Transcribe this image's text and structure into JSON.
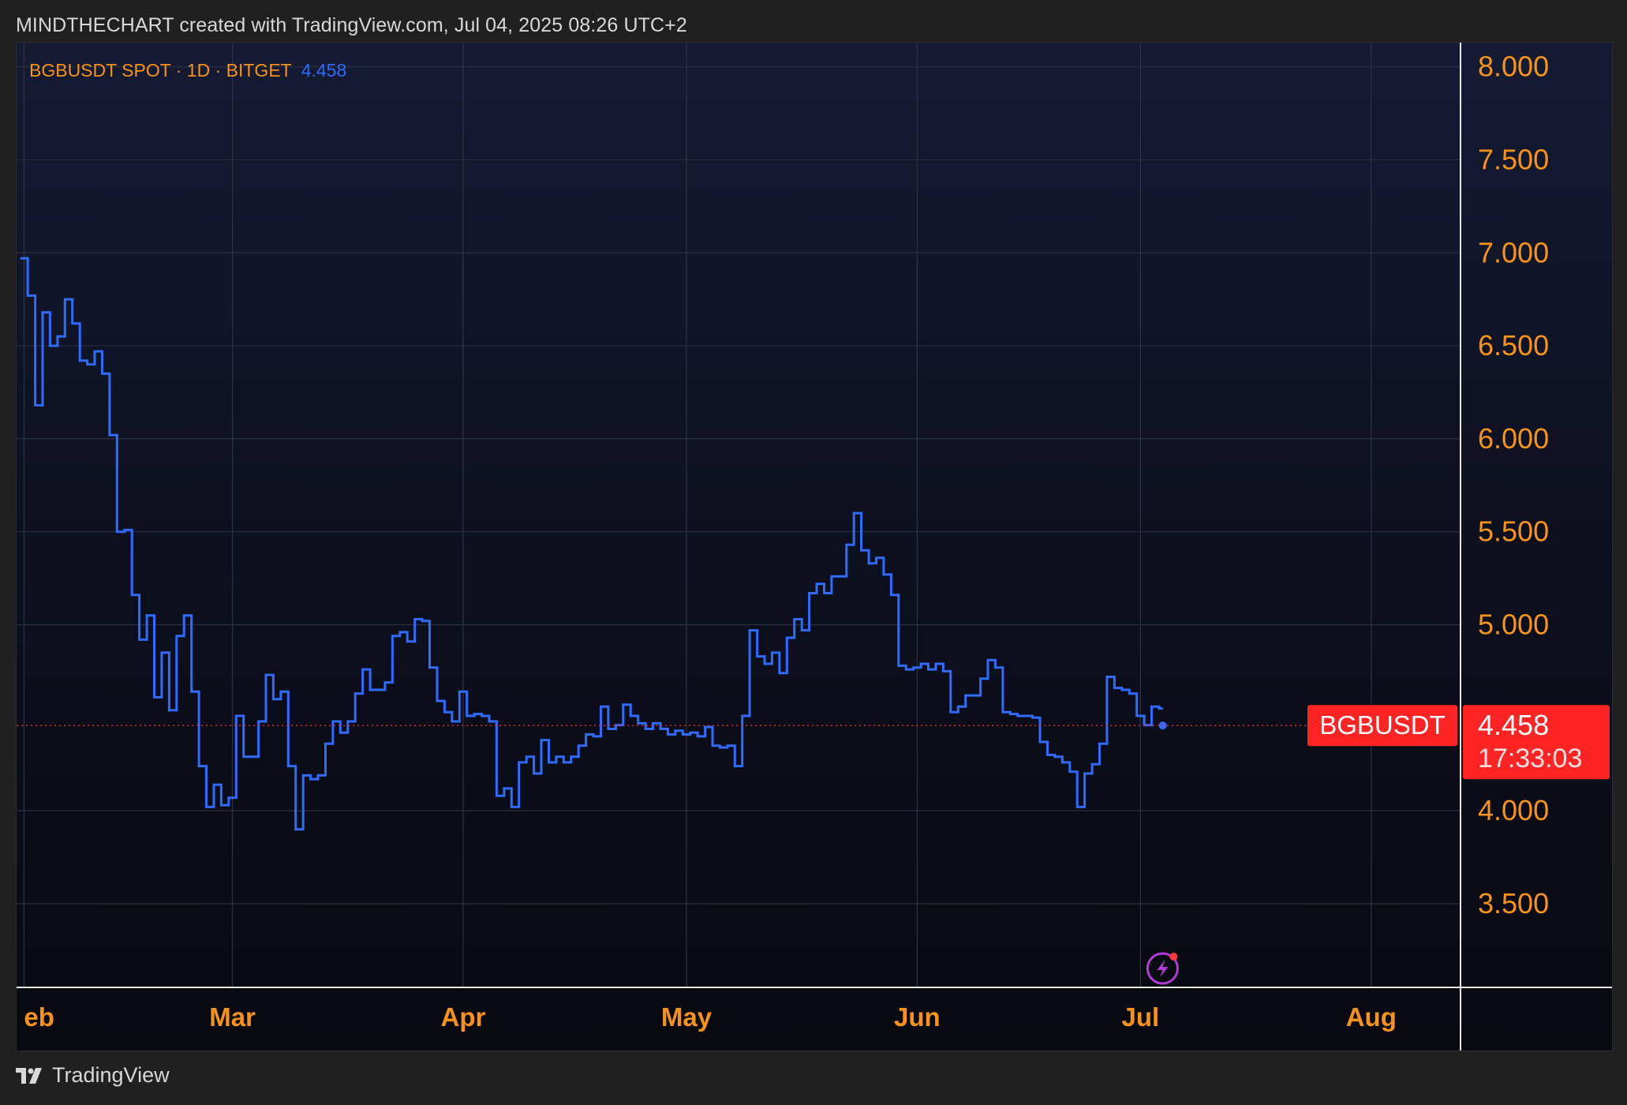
{
  "header": {
    "attribution": "MINDTHECHART created with TradingView.com, Jul 04, 2025 08:26 UTC+2"
  },
  "legend": {
    "symbol": "BGBUSDT SPOT · 1D · BITGET",
    "last_price": "4.458"
  },
  "price_tag": {
    "symbol": "BGBUSDT",
    "price": "4.458",
    "countdown": "17:33:03"
  },
  "footer": {
    "brand": "TradingView"
  },
  "colors": {
    "line": "#2f6bff",
    "axis_text": "#f7931a",
    "price_tag": "#ff2424"
  },
  "icons": {
    "lightning_badge": "lightning-icon",
    "logo": "tradingview-logo-icon"
  },
  "chart_data": {
    "type": "line",
    "style": "step",
    "title": "BGBUSDT SPOT · 1D · BITGET",
    "xlabel": "",
    "ylabel": "",
    "ylim": [
      3.05,
      8.13
    ],
    "xlim": [
      "2025-01-31",
      "2025-08-13"
    ],
    "grid": true,
    "y_ticks": [
      "8.000",
      "7.500",
      "7.000",
      "6.500",
      "6.000",
      "5.500",
      "5.000",
      "4.000",
      "3.500"
    ],
    "x_ticks": [
      {
        "label": "eb",
        "date": "2025-02-01"
      },
      {
        "label": "Mar",
        "date": "2025-03-01"
      },
      {
        "label": "Apr",
        "date": "2025-04-01"
      },
      {
        "label": "May",
        "date": "2025-05-01"
      },
      {
        "label": "Jun",
        "date": "2025-06-01"
      },
      {
        "label": "Jul",
        "date": "2025-07-01"
      },
      {
        "label": "Aug",
        "date": "2025-08-01"
      }
    ],
    "last_value": 4.458,
    "series": [
      {
        "dates": [
          "2025-02-01",
          "2025-02-02",
          "2025-02-03",
          "2025-02-04",
          "2025-02-05",
          "2025-02-06",
          "2025-02-07",
          "2025-02-08",
          "2025-02-09",
          "2025-02-10",
          "2025-02-11",
          "2025-02-12",
          "2025-02-13",
          "2025-02-14",
          "2025-02-15",
          "2025-02-16",
          "2025-02-17",
          "2025-02-18",
          "2025-02-19",
          "2025-02-20",
          "2025-02-21",
          "2025-02-22",
          "2025-02-23",
          "2025-02-24",
          "2025-02-25",
          "2025-02-26",
          "2025-02-27",
          "2025-02-28",
          "2025-03-01",
          "2025-03-02",
          "2025-03-03",
          "2025-03-04",
          "2025-03-05",
          "2025-03-06",
          "2025-03-07",
          "2025-03-08",
          "2025-03-09",
          "2025-03-10",
          "2025-03-11",
          "2025-03-12",
          "2025-03-13",
          "2025-03-14",
          "2025-03-15",
          "2025-03-16",
          "2025-03-17",
          "2025-03-18",
          "2025-03-19",
          "2025-03-20",
          "2025-03-21",
          "2025-03-22",
          "2025-03-23",
          "2025-03-24",
          "2025-03-25",
          "2025-03-26",
          "2025-03-27",
          "2025-03-28",
          "2025-03-29",
          "2025-03-30",
          "2025-03-31",
          "2025-04-01",
          "2025-04-02",
          "2025-04-03",
          "2025-04-04",
          "2025-04-05",
          "2025-04-06",
          "2025-04-07",
          "2025-04-08",
          "2025-04-09",
          "2025-04-10",
          "2025-04-11",
          "2025-04-12",
          "2025-04-13",
          "2025-04-14",
          "2025-04-15",
          "2025-04-16",
          "2025-04-17",
          "2025-04-18",
          "2025-04-19",
          "2025-04-20",
          "2025-04-21",
          "2025-04-22",
          "2025-04-23",
          "2025-04-24",
          "2025-04-25",
          "2025-04-26",
          "2025-04-27",
          "2025-04-28",
          "2025-04-29",
          "2025-04-30",
          "2025-05-01",
          "2025-05-02",
          "2025-05-03",
          "2025-05-04",
          "2025-05-05",
          "2025-05-06",
          "2025-05-07",
          "2025-05-08",
          "2025-05-09",
          "2025-05-10",
          "2025-05-11",
          "2025-05-12",
          "2025-05-13",
          "2025-05-14",
          "2025-05-15",
          "2025-05-16",
          "2025-05-17",
          "2025-05-18",
          "2025-05-19",
          "2025-05-20",
          "2025-05-21",
          "2025-05-22",
          "2025-05-23",
          "2025-05-24",
          "2025-05-25",
          "2025-05-26",
          "2025-05-27",
          "2025-05-28",
          "2025-05-29",
          "2025-05-30",
          "2025-05-31",
          "2025-06-01",
          "2025-06-02",
          "2025-06-03",
          "2025-06-04",
          "2025-06-05",
          "2025-06-06",
          "2025-06-07",
          "2025-06-08",
          "2025-06-09",
          "2025-06-10",
          "2025-06-11",
          "2025-06-12",
          "2025-06-13",
          "2025-06-14",
          "2025-06-15",
          "2025-06-16",
          "2025-06-17",
          "2025-06-18",
          "2025-06-19",
          "2025-06-20",
          "2025-06-21",
          "2025-06-22",
          "2025-06-23",
          "2025-06-24",
          "2025-06-25",
          "2025-06-26",
          "2025-06-27",
          "2025-06-28",
          "2025-06-29",
          "2025-06-30",
          "2025-07-01",
          "2025-07-02",
          "2025-07-03",
          "2025-07-04"
        ],
        "values": [
          6.97,
          6.77,
          6.18,
          6.68,
          6.5,
          6.55,
          6.75,
          6.62,
          6.42,
          6.4,
          6.47,
          6.35,
          6.02,
          5.5,
          5.51,
          5.16,
          4.92,
          5.05,
          4.61,
          4.85,
          4.54,
          4.94,
          5.05,
          4.64,
          4.24,
          4.02,
          4.14,
          4.03,
          4.07,
          4.51,
          4.29,
          4.29,
          4.48,
          4.73,
          4.6,
          4.64,
          4.24,
          3.9,
          4.19,
          4.17,
          4.19,
          4.36,
          4.48,
          4.42,
          4.48,
          4.63,
          4.76,
          4.65,
          4.65,
          4.69,
          4.94,
          4.96,
          4.91,
          5.03,
          5.02,
          4.77,
          4.59,
          4.53,
          4.48,
          4.64,
          4.51,
          4.52,
          4.51,
          4.48,
          4.08,
          4.12,
          4.02,
          4.26,
          4.29,
          4.2,
          4.38,
          4.26,
          4.29,
          4.26,
          4.29,
          4.35,
          4.41,
          4.4,
          4.56,
          4.44,
          4.46,
          4.57,
          4.51,
          4.47,
          4.44,
          4.47,
          4.44,
          4.41,
          4.43,
          4.41,
          4.42,
          4.4,
          4.45,
          4.35,
          4.34,
          4.35,
          4.24,
          4.51,
          4.97,
          4.83,
          4.79,
          4.85,
          4.74,
          4.93,
          5.03,
          4.97,
          5.17,
          5.22,
          5.17,
          5.26,
          5.26,
          5.43,
          5.6,
          5.4,
          5.33,
          5.36,
          5.27,
          5.16,
          4.78,
          4.76,
          4.77,
          4.79,
          4.76,
          4.79,
          4.75,
          4.53,
          4.56,
          4.62,
          4.62,
          4.71,
          4.81,
          4.77,
          4.53,
          4.52,
          4.51,
          4.51,
          4.5,
          4.37,
          4.3,
          4.29,
          4.26,
          4.21,
          4.02,
          4.2,
          4.25,
          4.36,
          4.72,
          4.66,
          4.65,
          4.63,
          4.51,
          4.46,
          4.56,
          4.55,
          4.458
        ]
      }
    ]
  }
}
